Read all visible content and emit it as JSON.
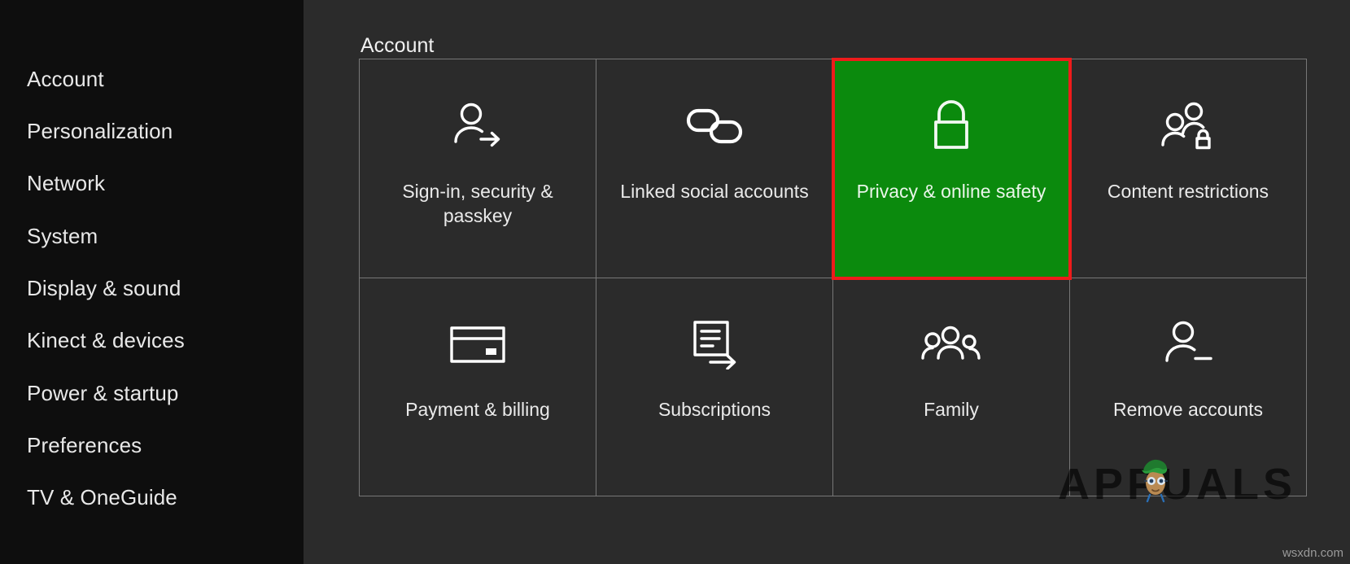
{
  "window": {
    "background_color": "#2b2b2b",
    "sidebar_color": "#0e0e0e"
  },
  "sidebar": {
    "items": [
      {
        "label": "Account",
        "icon": "account-icon",
        "selected": true
      },
      {
        "label": "Personalization",
        "icon": "personalization-icon",
        "selected": false
      },
      {
        "label": "Network",
        "icon": "network-icon",
        "selected": false
      },
      {
        "label": "System",
        "icon": "system-icon",
        "selected": false
      },
      {
        "label": "Display & sound",
        "icon": "display-icon",
        "selected": false
      },
      {
        "label": "Kinect & devices",
        "icon": "devices-icon",
        "selected": false
      },
      {
        "label": "Power & startup",
        "icon": "power-icon",
        "selected": false
      },
      {
        "label": "Preferences",
        "icon": "preferences-icon",
        "selected": false
      },
      {
        "label": "TV & OneGuide",
        "icon": "tv-icon",
        "selected": false
      }
    ]
  },
  "main": {
    "title": "Account",
    "highlight_color": "#ee1b1b",
    "selected_tile_color": "#0b8a0d",
    "tiles": [
      {
        "label": "Sign-in, security & passkey",
        "icon": "person-arrow-icon",
        "selected": false
      },
      {
        "label": "Linked social accounts",
        "icon": "chain-links-icon",
        "selected": false
      },
      {
        "label": "Privacy & online safety",
        "icon": "lock-icon",
        "selected": true
      },
      {
        "label": "Content restrictions",
        "icon": "people-lock-icon",
        "selected": false
      },
      {
        "label": "Payment & billing",
        "icon": "credit-card-icon",
        "selected": false
      },
      {
        "label": "Subscriptions",
        "icon": "document-arrow-icon",
        "selected": false
      },
      {
        "label": "Family",
        "icon": "people-group-icon",
        "selected": false
      },
      {
        "label": "Remove accounts",
        "icon": "person-minus-icon",
        "selected": false
      }
    ]
  },
  "watermarks": {
    "brand": "APPUALS",
    "site": "wsxdn.com"
  }
}
